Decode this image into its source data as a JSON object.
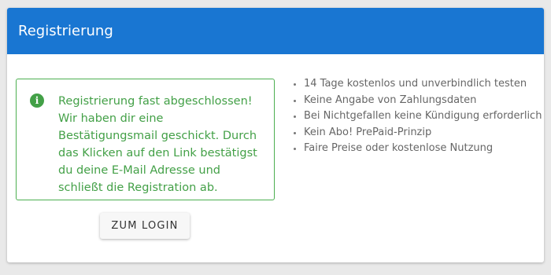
{
  "header": {
    "title": "Registrierung"
  },
  "alert": {
    "icon": "info-icon",
    "message": "Registrierung fast abgeschlossen! Wir haben dir eine Bestätigungsmail geschickt. Durch das Klicken auf den Link bestätigst du deine E-Mail Adresse und schließt die Registration ab.",
    "color": "#43a047"
  },
  "login_button": {
    "label": "ZUM LOGIN"
  },
  "features": [
    "14 Tage kostenlos und unverbindlich testen",
    "Keine Angabe von Zahlungsdaten",
    "Bei Nichtgefallen keine Kündigung erforderlich",
    "Kein Abo! PrePaid-Prinzip",
    "Faire Preise oder kostenlose Nutzung"
  ],
  "colors": {
    "header_bg": "#1976d2",
    "success": "#4caf50"
  }
}
